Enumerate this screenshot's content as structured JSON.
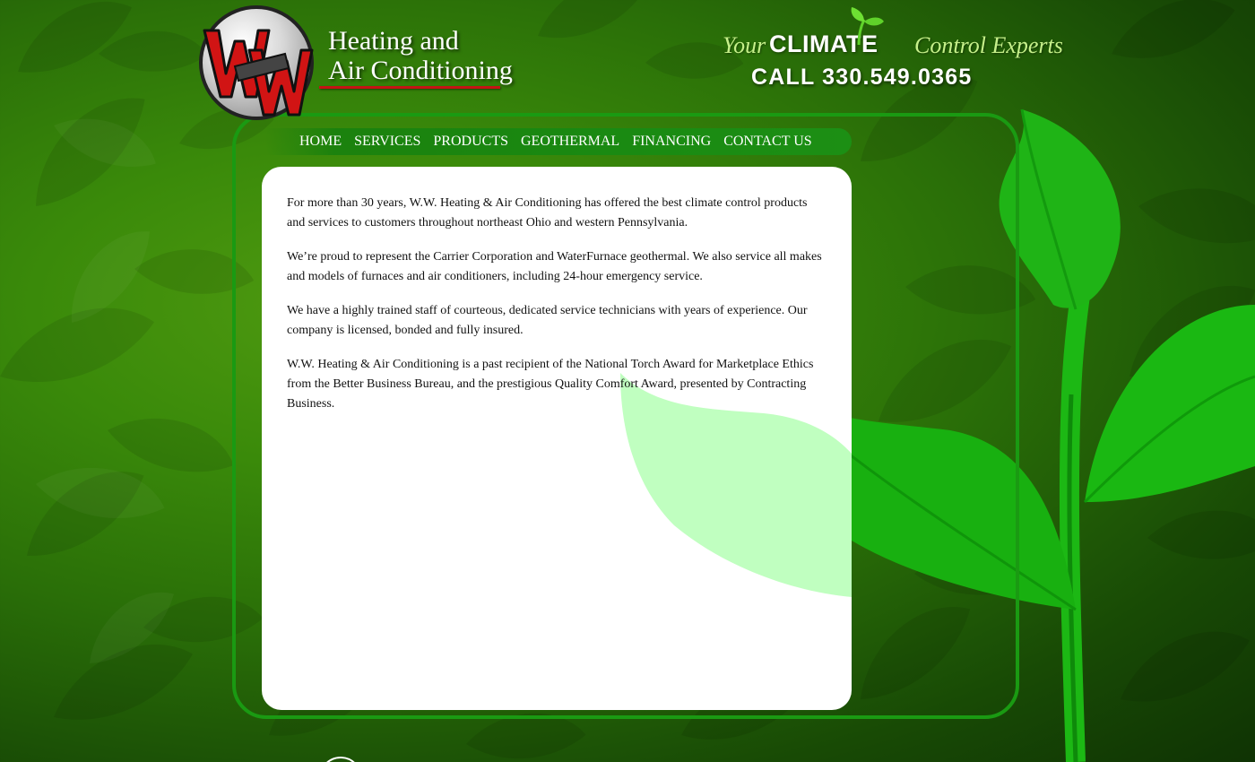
{
  "brand": {
    "logo_mark_letters": "WW",
    "logo_mark_small": "INC.",
    "name_line1": "Heating and",
    "name_line2": "Air Conditioning"
  },
  "tagline": {
    "your": "Your",
    "climate": "CLIMATE",
    "control": "Control Experts",
    "phone": "CALL 330.549.0365"
  },
  "nav": {
    "items": [
      {
        "label": "HOME"
      },
      {
        "label": "SERVICES"
      },
      {
        "label": "PRODUCTS"
      },
      {
        "label": "GEOTHERMAL"
      },
      {
        "label": "FINANCING"
      },
      {
        "label": "CONTACT US"
      }
    ]
  },
  "content": {
    "paragraphs": [
      "For more than 30 years, W.W. Heating & Air Conditioning has offered the best climate control products and services to customers throughout northeast Ohio and western Pennsylvania.",
      "We’re proud to represent the Carrier Corporation and WaterFurnace geothermal. We also service all makes and models of furnaces and air conditioners, including 24-hour emergency service.",
      "We have a highly trained staff of courteous, dedicated service technicians with years of experience. Our company is licensed, bonded and fully insured.",
      "W.W. Heating & Air Conditioning is a past recipient of the National Torch Award for Marketplace Ethics from the Better Business Bureau, and the prestigious Quality Comfort Award, presented by Contracting Business."
    ]
  },
  "colors": {
    "background_green": "#3a8a0a",
    "accent_green": "#1a9a12",
    "tagline_light_green": "#c6f08a",
    "logo_red": "#c41414"
  }
}
